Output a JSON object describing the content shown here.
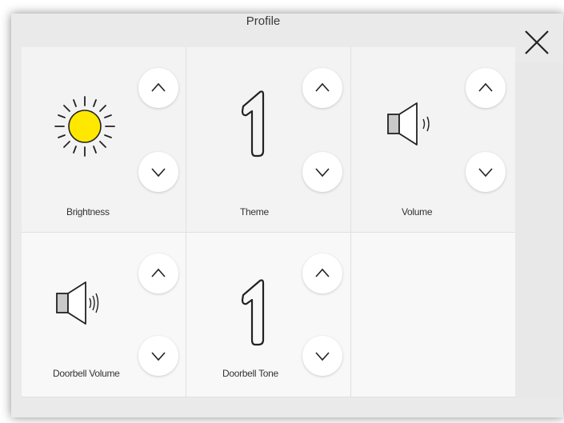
{
  "header": {
    "title": "Profile"
  },
  "tiles": [
    {
      "label": "Brightness",
      "icon": "sun-icon"
    },
    {
      "label": "Theme",
      "icon": "number-one-icon"
    },
    {
      "label": "Volume",
      "icon": "speaker-icon"
    },
    {
      "label": "Doorbell Volume",
      "icon": "speaker-icon"
    },
    {
      "label": "Doorbell Tone",
      "icon": "number-one-icon"
    }
  ],
  "icons": {
    "close": "close-icon",
    "up": "chevron-up-icon",
    "down": "chevron-down-icon"
  },
  "colors": {
    "sun_fill": "#ffe800",
    "speaker_fill": "#c9c9c9",
    "icon_stroke": "#222222"
  }
}
